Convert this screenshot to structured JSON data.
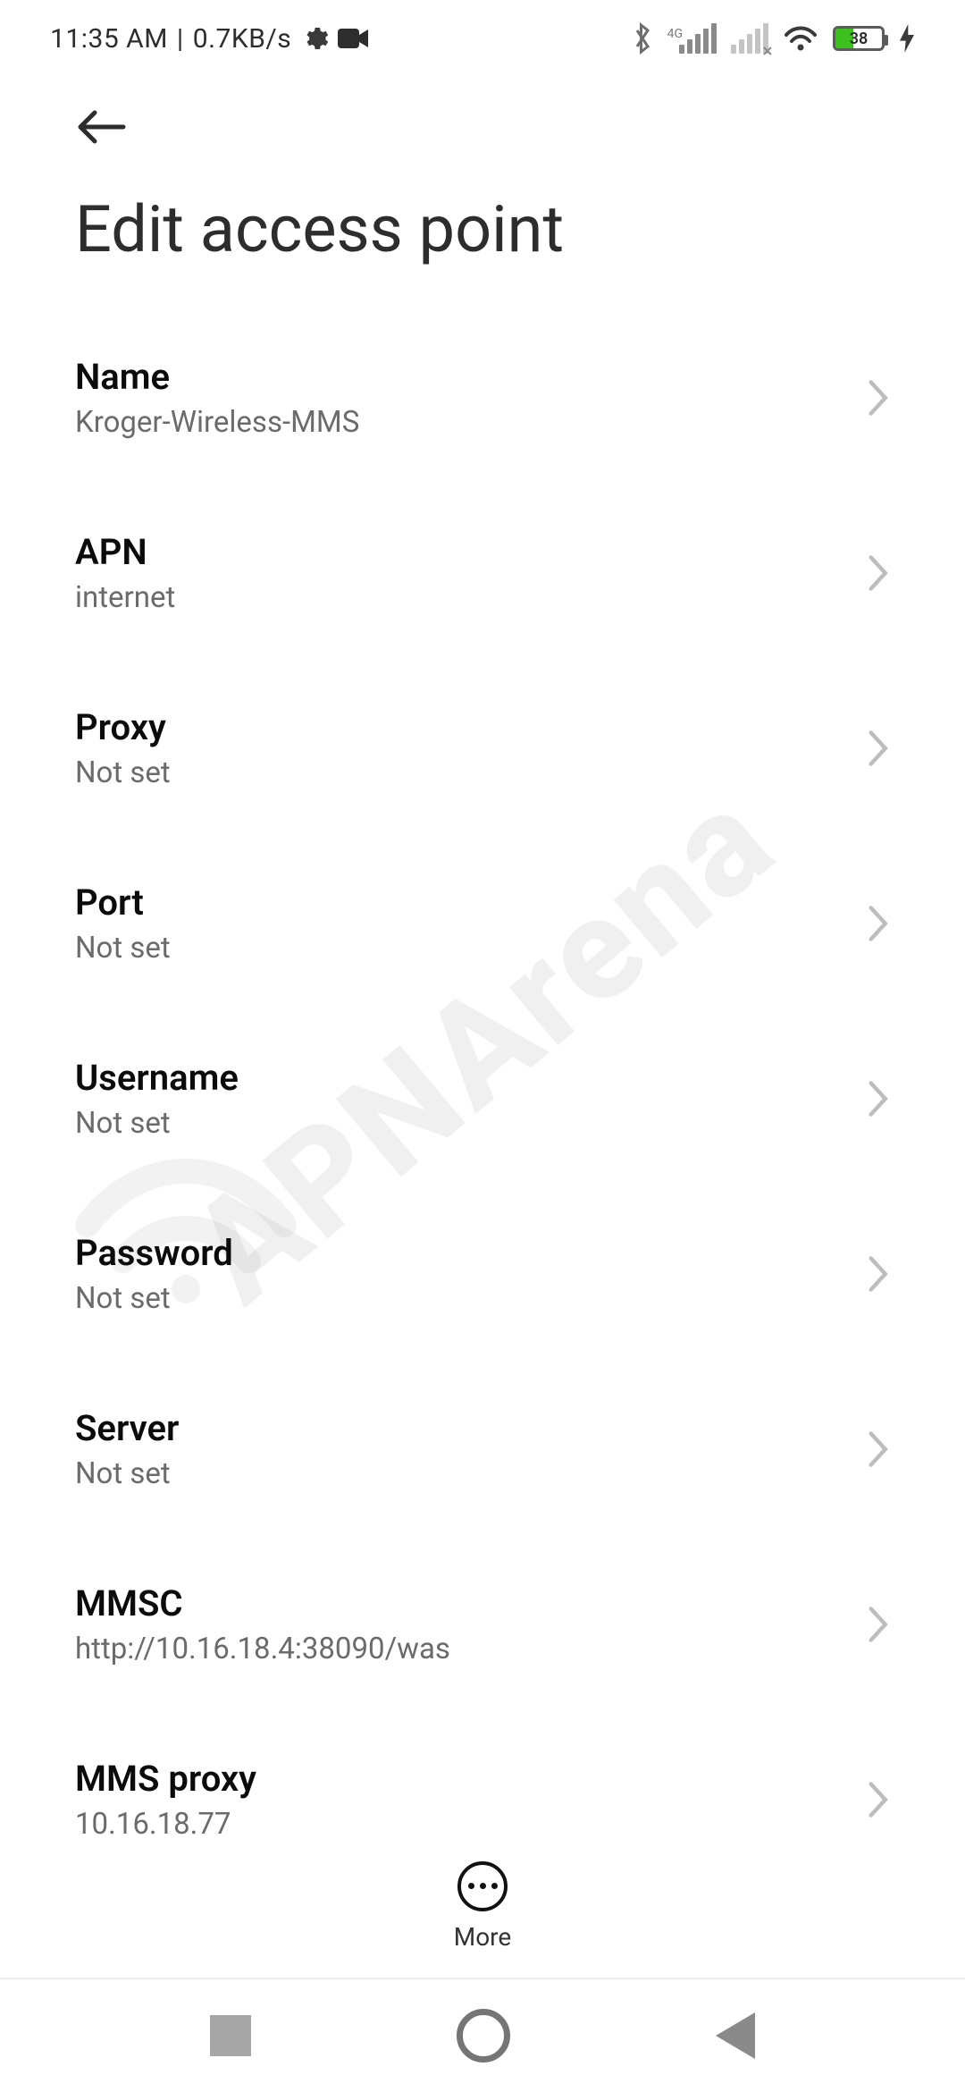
{
  "status": {
    "time": "11:35 AM",
    "net_rate": "0.7KB/s",
    "network_badge": "4G",
    "battery_pct": "38"
  },
  "header": {
    "title": "Edit access point"
  },
  "fields": [
    {
      "label": "Name",
      "value": "Kroger-Wireless-MMS",
      "key": "name"
    },
    {
      "label": "APN",
      "value": "internet",
      "key": "apn"
    },
    {
      "label": "Proxy",
      "value": "Not set",
      "key": "proxy"
    },
    {
      "label": "Port",
      "value": "Not set",
      "key": "port"
    },
    {
      "label": "Username",
      "value": "Not set",
      "key": "username"
    },
    {
      "label": "Password",
      "value": "Not set",
      "key": "password"
    },
    {
      "label": "Server",
      "value": "Not set",
      "key": "server"
    },
    {
      "label": "MMSC",
      "value": "http://10.16.18.4:38090/was",
      "key": "mmsc"
    },
    {
      "label": "MMS proxy",
      "value": "10.16.18.77",
      "key": "mms-proxy"
    }
  ],
  "quick_action": {
    "label": "More"
  },
  "watermark": {
    "text": "APNArena"
  }
}
